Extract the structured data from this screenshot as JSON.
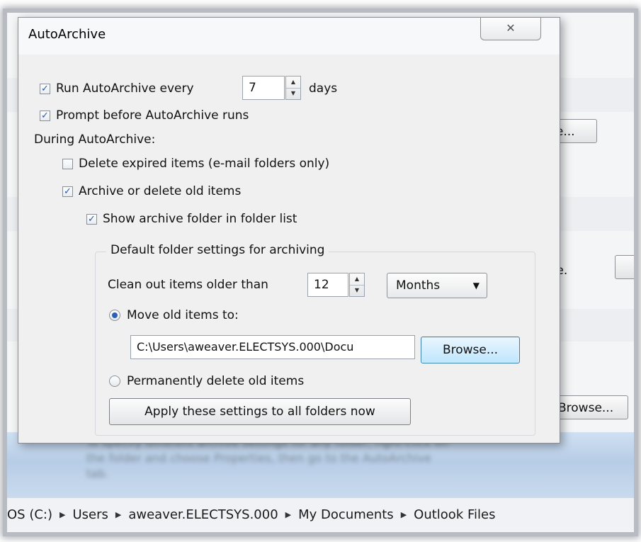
{
  "background": {
    "browse_partial_label": "se...",
    "file_text": "file.",
    "browse_label": "Browse...",
    "blurred_text": "To specify different archive settings for any folder, right-click on the folder and choose Properties, then go to the AutoArchive tab."
  },
  "breadcrumb": [
    "OS (C:)",
    "Users",
    "aweaver.ELECTSYS.000",
    "My Documents",
    "Outlook Files"
  ],
  "dialog": {
    "title": "AutoArchive",
    "close_icon": "close-icon",
    "run_every_label": "Run AutoArchive every",
    "run_every_value": "7",
    "days_label": "days",
    "prompt_label": "Prompt before AutoArchive runs",
    "during_label": "During AutoArchive:",
    "delete_expired_label": "Delete expired items (e-mail folders only)",
    "archive_old_label": "Archive or delete old items",
    "show_folder_label": "Show archive folder in folder list",
    "group_label": "Default folder settings for archiving",
    "clean_out_label": "Clean out items older than",
    "clean_out_value": "12",
    "period_selected": "Months",
    "move_old_label": "Move old items to:",
    "path_value": "C:\\Users\\aweaver.ELECTSYS.000\\Docu",
    "browse_label": "Browse...",
    "permanently_delete_label": "Permanently delete old items",
    "apply_label": "Apply these settings to all folders now",
    "checked": {
      "run_every": true,
      "prompt": true,
      "delete_expired": false,
      "archive_old": true,
      "show_folder": true
    },
    "radio_selected": "move"
  }
}
